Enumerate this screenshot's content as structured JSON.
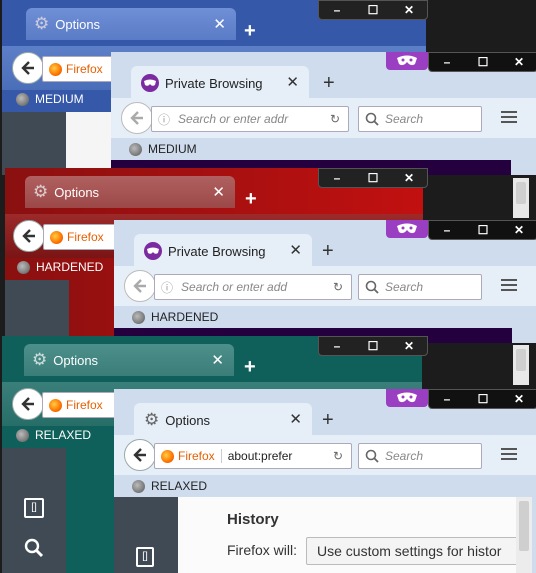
{
  "windows": [
    {
      "back_tab": "Options",
      "back_profile": "MEDIUM",
      "back_identity": "Firefox",
      "front_tab": "Private Browsing",
      "front_profile": "MEDIUM",
      "url_placeholder": "Search or enter addr",
      "search_placeholder": "Search",
      "back_color": "#3a5fb0",
      "content_color": "#25003e"
    },
    {
      "back_tab": "Options",
      "back_profile": "HARDENED",
      "back_identity": "Firefox",
      "front_tab": "Private Browsing",
      "front_profile": "HARDENED",
      "url_placeholder": "Search or enter add",
      "search_placeholder": "Search",
      "back_color": "#8a0e0e",
      "content_color": "#25003e"
    },
    {
      "back_tab": "Options",
      "back_profile": "RELAXED",
      "back_identity": "Firefox",
      "front_tab": "Options",
      "front_profile": "RELAXED",
      "url_identity": "Firefox",
      "url_value": "about:prefer",
      "search_placeholder": "Search",
      "back_color": "#1d6c66",
      "history_heading": "History",
      "history_label": "Firefox will:",
      "history_select": "Use custom settings for histor"
    }
  ],
  "window_controls": {
    "minimize": "–",
    "maximize": "☐",
    "close": "✕"
  },
  "icons": {
    "back": "back-arrow-icon",
    "gear": "gear-icon",
    "private": "private-mask-icon",
    "reload": "reload-icon",
    "search": "search-icon",
    "menu": "hamburger-menu-icon"
  }
}
